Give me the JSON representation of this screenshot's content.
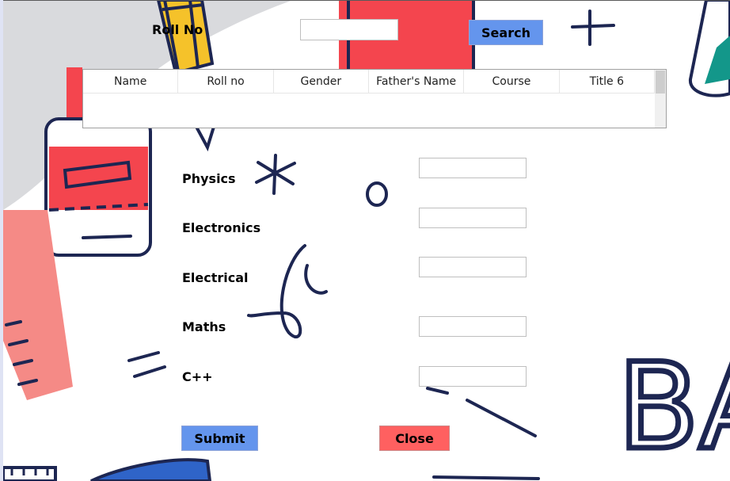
{
  "search": {
    "roll_label": "Roll No",
    "roll_value": "",
    "search_label": "Search"
  },
  "grid": {
    "columns": [
      "Name",
      "Roll no",
      "Gender",
      "Father's Name",
      "Course",
      "Title 6"
    ]
  },
  "subjects": [
    {
      "label": "Physics",
      "value": ""
    },
    {
      "label": "Electronics",
      "value": ""
    },
    {
      "label": "Electrical",
      "value": ""
    },
    {
      "label": "Maths",
      "value": ""
    },
    {
      "label": "C++",
      "value": ""
    }
  ],
  "actions": {
    "submit_label": "Submit",
    "close_label": "Close"
  },
  "background": {
    "decor_text": "BA"
  },
  "colors": {
    "primary_button": "#6495ed",
    "close_button": "#ff6060",
    "decor_red": "#f4454e",
    "decor_navy": "#1d2652",
    "decor_yellow": "#f5c22a",
    "decor_teal": "#13978a"
  }
}
